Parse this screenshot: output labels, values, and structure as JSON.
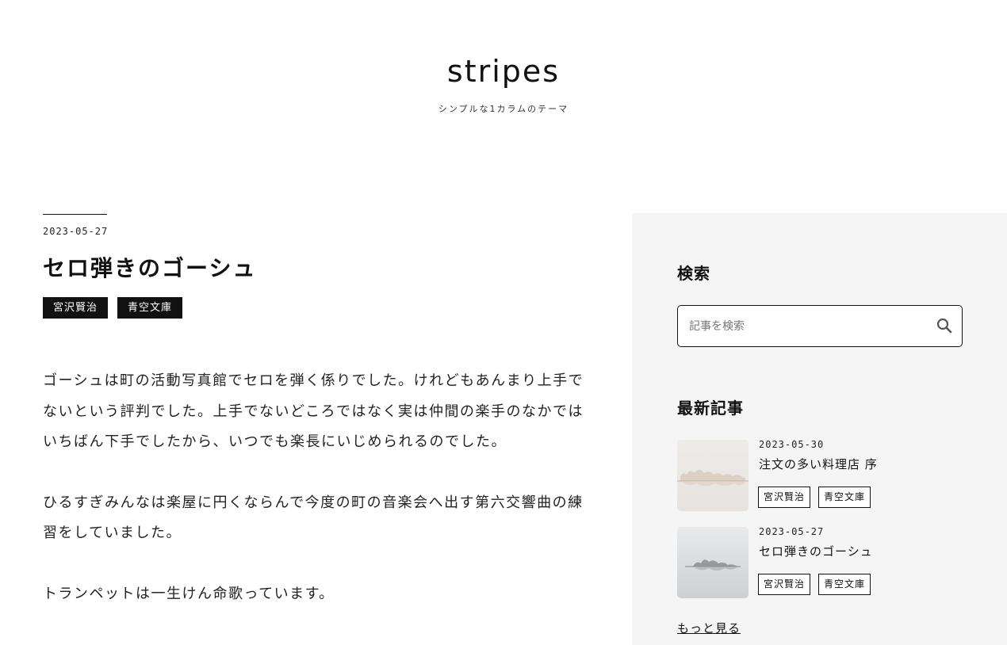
{
  "site": {
    "title": "stripes",
    "description": "シンプルな1カラムのテーマ"
  },
  "article": {
    "date": "2023-05-27",
    "title": "セロ弾きのゴーシュ",
    "tags": [
      "宮沢賢治",
      "青空文庫"
    ],
    "paragraphs": [
      "ゴーシュは町の活動写真館でセロを弾く係りでした。けれどもあんまり上手でないという評判でした。上手でないどころではなく実は仲間の楽手のなかではいちばん下手でしたから、いつでも楽長にいじめられるのでした。",
      "ひるすぎみんなは楽屋に円くならんで今度の町の音楽会へ出す第六交響曲の練習をしていました。",
      "トランペットは一生けん命歌っています。"
    ]
  },
  "sidebar": {
    "search": {
      "title": "検索",
      "placeholder": "記事を検索",
      "icon": "search-icon"
    },
    "recent": {
      "title": "最新記事",
      "posts": [
        {
          "date": "2023-05-30",
          "title": "注文の多い料理店 序",
          "tags": [
            "宮沢賢治",
            "青空文庫"
          ]
        },
        {
          "date": "2023-05-27",
          "title": "セロ弾きのゴーシュ",
          "tags": [
            "宮沢賢治",
            "青空文庫"
          ]
        }
      ],
      "more_label": "もっと見る"
    }
  },
  "colors": {
    "text": "#111111",
    "sidebar_bg": "#f5f5f5",
    "tag_dark_bg": "#111111"
  }
}
